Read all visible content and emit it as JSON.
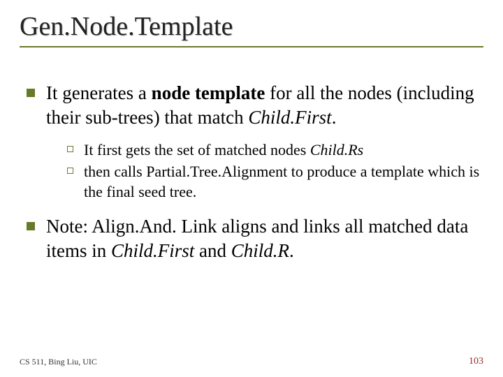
{
  "title": "Gen.Node.Template",
  "bullets": {
    "item1_part1": "It generates a ",
    "item1_bold": "node template",
    "item1_part2": " for all the nodes (including their sub-trees) that match ",
    "item1_italic": "Child.First",
    "item1_part3": ".",
    "sub1_part1": "It first gets the set of matched nodes ",
    "sub1_italic": "Child.Rs",
    "sub2": "then calls Partial.Tree.Alignment to produce a template which is the final seed tree.",
    "item2_part1": "Note: Align.And. Link aligns and links all matched data items in ",
    "item2_italic1": "Child.First",
    "item2_mid": " and ",
    "item2_italic2": "Child.R",
    "item2_end": "."
  },
  "footer_left": "CS 511, Bing Liu, UIC",
  "footer_right": "103"
}
